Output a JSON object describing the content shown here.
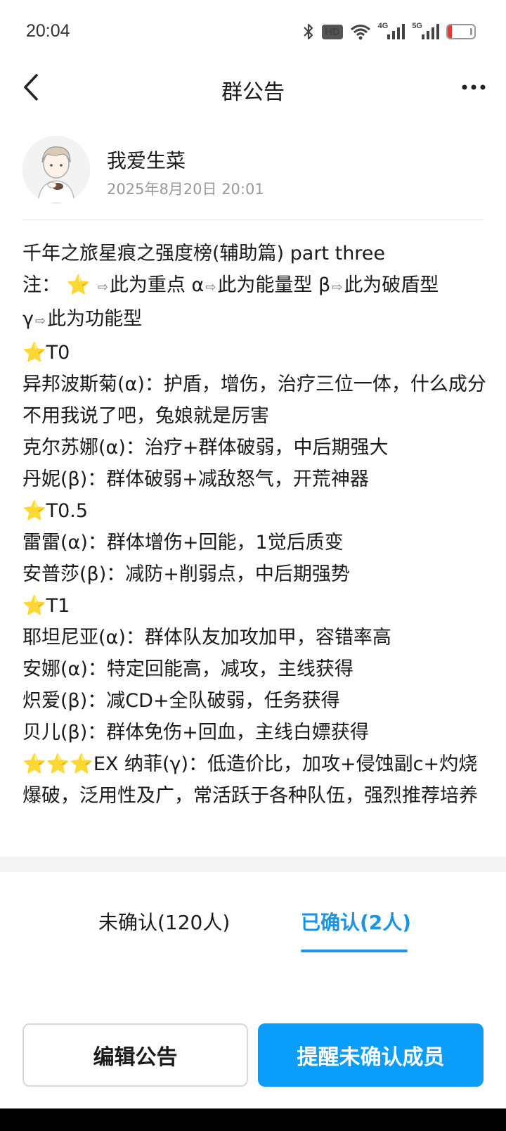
{
  "status_bar": {
    "time": "20:04",
    "hd_label": "HD",
    "net1": "4G",
    "net2": "5G",
    "battery_level": "16",
    "battery_fraction": 0.16
  },
  "nav": {
    "title": "群公告",
    "back_icon": "chevron-left-icon",
    "more_icon": "more-horizontal-icon"
  },
  "author": {
    "name": "我爱生菜",
    "time": "2025年8月20日 20:01"
  },
  "announcement": {
    "title": "千年之旅星痕之强度榜(辅助篇) part three",
    "note_prefix": "注：",
    "note_1": "此为重点 α",
    "note_2": "此为能量型 β",
    "note_3": "此为破盾型",
    "note_4": "γ",
    "note_5": "此为功能型",
    "tier_t0": "T0",
    "t0_1": "异邦波斯菊(α)：护盾，增伤，治疗三位一体，什么成分不用我说了吧，兔娘就是厉害",
    "t0_2": "克尔苏娜(α)：治疗+群体破弱，中后期强大",
    "t0_3": "丹妮(β)：群体破弱+减敌怒气，开荒神器",
    "tier_t05": "T0.5",
    "t05_1": "雷雷(α)：群体增伤+回能，1觉后质变",
    "t05_2": "安普莎(β)：减防+削弱点，中后期强势",
    "tier_t1": "T1",
    "t1_1": "耶坦尼亚(α)：群体队友加攻加甲，容错率高",
    "t1_2": "安娜(α)：特定回能高，减攻，主线获得",
    "t1_3": "炽爱(β)：减CD+全队破弱，任务获得",
    "t1_4": "贝儿(β)：群体免伤+回血，主线白嫖获得",
    "ex_line": "EX 纳菲(γ)：低造价比，加攻+侵蚀副c+灼烧爆破，泛用性及广，常活跃于各种队伍，强烈推荐培养",
    "star": "⭐",
    "arrow": "⇨"
  },
  "tabs": {
    "unconfirmed": "未确认(120人)",
    "confirmed": "已确认(2人)",
    "active": "confirmed",
    "active_color": "#1b94e6"
  },
  "buttons": {
    "edit": "编辑公告",
    "remind": "提醒未确认成员",
    "primary_color": "#0a9dfa"
  }
}
